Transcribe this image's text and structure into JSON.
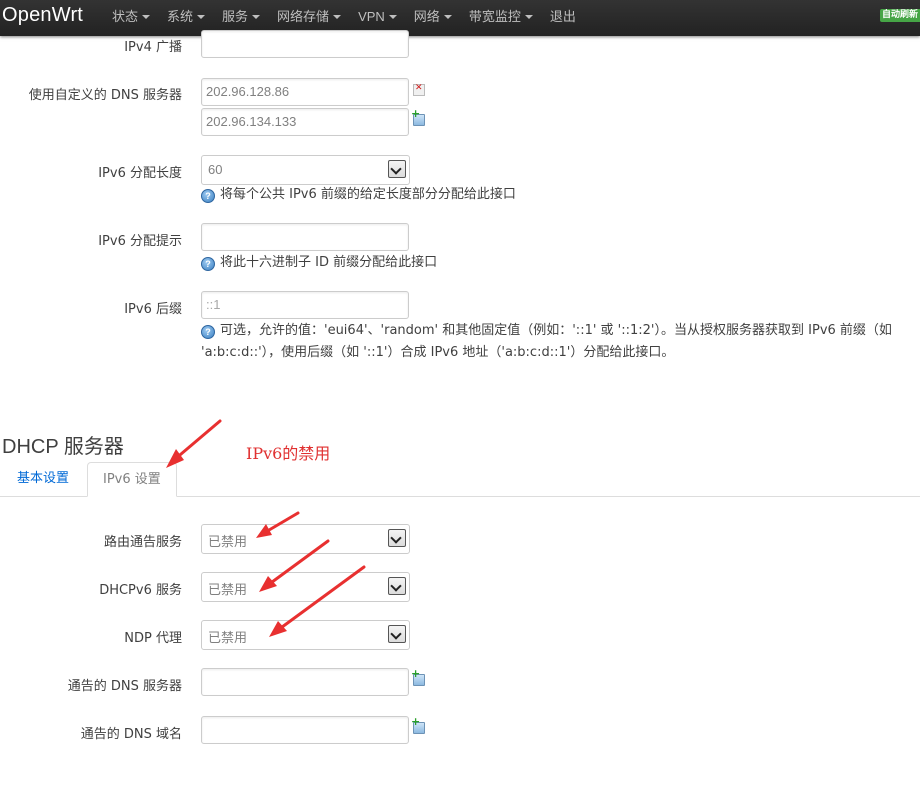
{
  "navbar": {
    "brand": "OpenWrt",
    "menu": [
      {
        "label": "状态",
        "dropdown": true
      },
      {
        "label": "系统",
        "dropdown": true
      },
      {
        "label": "服务",
        "dropdown": true
      },
      {
        "label": "网络存储",
        "dropdown": true
      },
      {
        "label": "VPN",
        "dropdown": true
      },
      {
        "label": "网络",
        "dropdown": true
      },
      {
        "label": "带宽监控",
        "dropdown": true
      },
      {
        "label": "退出",
        "dropdown": false
      }
    ],
    "auto_refresh_badge": "自动刷新"
  },
  "top_form": {
    "ipv4_broadcast": {
      "label": "IPv4 广播",
      "value": ""
    },
    "custom_dns": {
      "label": "使用自定义的 DNS 服务器",
      "values": [
        "202.96.128.86",
        "202.96.134.133"
      ]
    },
    "ipv6_assign_length": {
      "label": "IPv6 分配长度",
      "value": "60",
      "help": "将每个公共 IPv6 前缀的给定长度部分分配给此接口"
    },
    "ipv6_assign_hint": {
      "label": "IPv6 分配提示",
      "value": "",
      "help": "将此十六进制子 ID 前缀分配给此接口"
    },
    "ipv6_suffix": {
      "label": "IPv6 后缀",
      "placeholder": "::1",
      "help_line1": "可选，允许的值：'eui64'、'random' 和其他固定值（例如：'::1' 或 '::1:2'）。当从授权服务器获取到 IPv6 前缀（如",
      "help_line2": "'a:b:c:d::'），使用后缀（如 '::1'）合成 IPv6 地址（'a:b:c:d::1'）分配给此接口。"
    }
  },
  "dhcp": {
    "title": "DHCP 服务器",
    "tabs": [
      {
        "label": "基本设置",
        "active": false
      },
      {
        "label": "IPv6 设置",
        "active": true
      }
    ],
    "annotation": "IPv6的禁用",
    "fields": {
      "ra_service": {
        "label": "路由通告服务",
        "value": "已禁用"
      },
      "dhcpv6_service": {
        "label": "DHCPv6 服务",
        "value": "已禁用"
      },
      "ndp_proxy": {
        "label": "NDP 代理",
        "value": "已禁用"
      },
      "announced_dns_servers": {
        "label": "通告的 DNS 服务器",
        "value": ""
      },
      "announced_dns_domains": {
        "label": "通告的 DNS 域名",
        "value": ""
      }
    }
  },
  "colors": {
    "navbar_bg": "#222222",
    "link": "#0069d6",
    "annotation_red": "#e03030",
    "badge_green": "#46a546"
  }
}
